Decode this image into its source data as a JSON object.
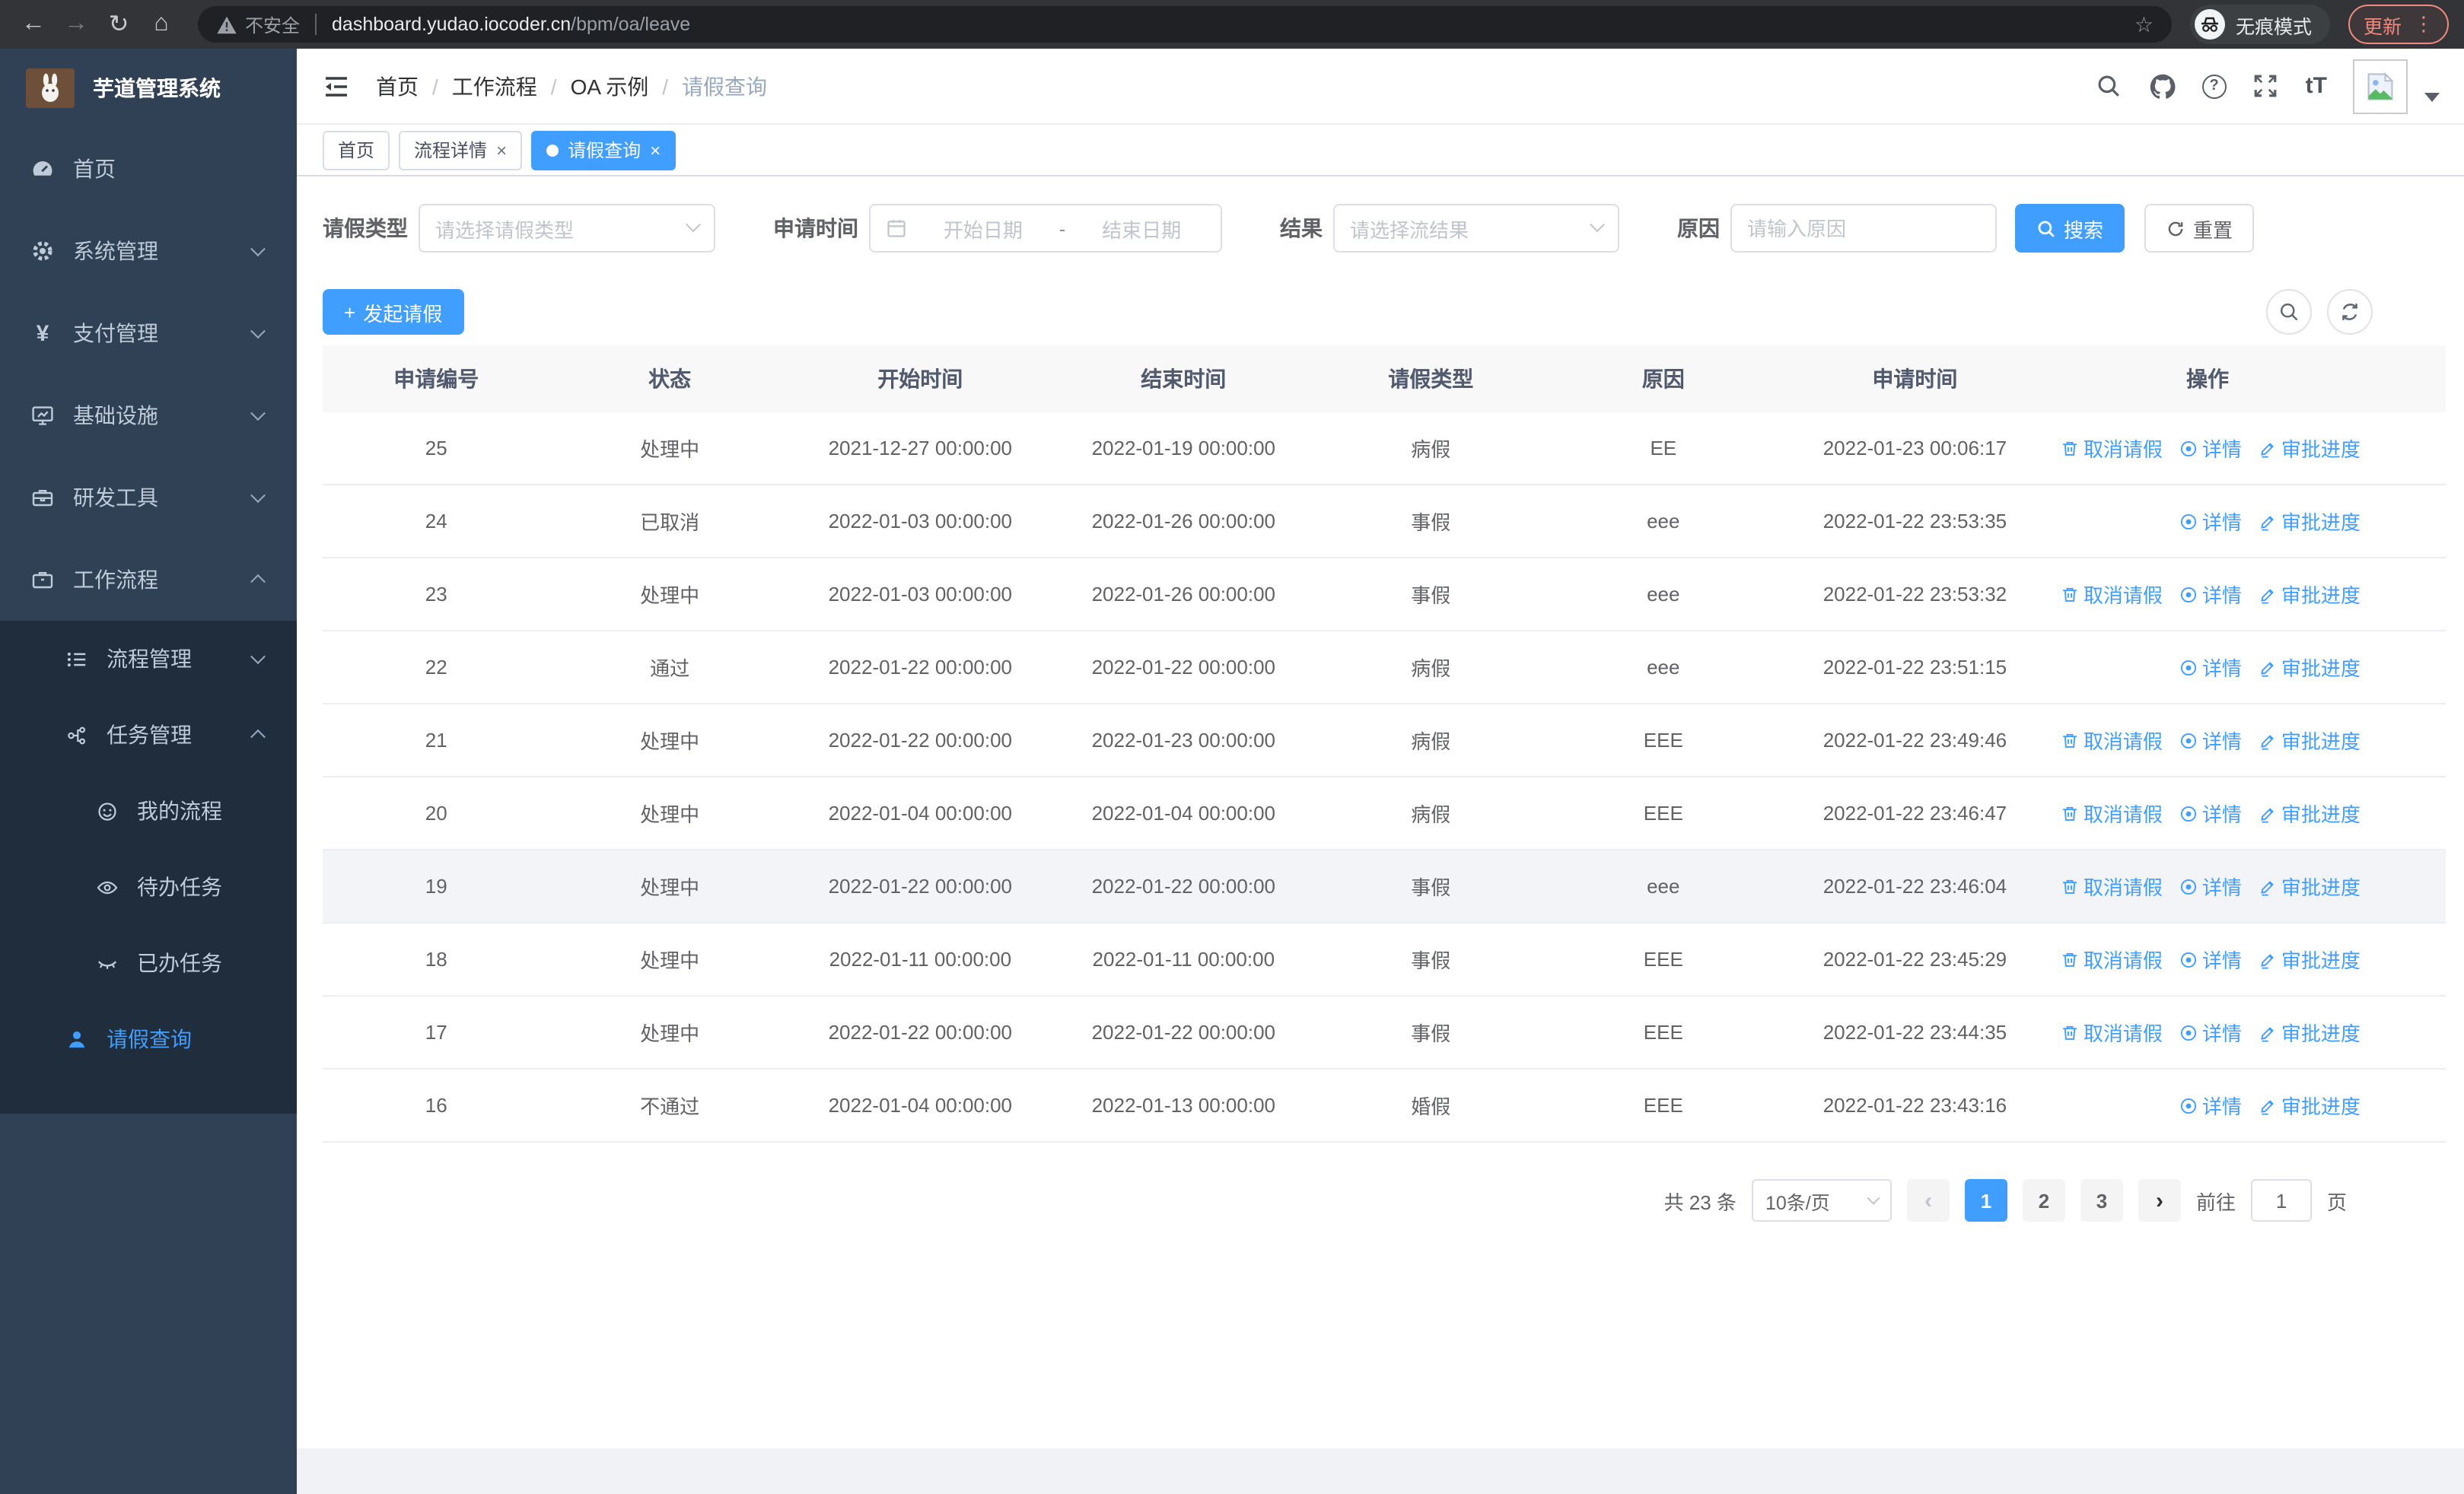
{
  "browser": {
    "security_label": "不安全",
    "url_host": "dashboard.yudao.iocoder.cn",
    "url_path": "/bpm/oa/leave",
    "incognito_label": "无痕模式",
    "update_label": "更新"
  },
  "glyphs": {
    "back": "←",
    "forward": "→",
    "reload": "↻",
    "home": "⌂",
    "star": "☆",
    "more": "⋮",
    "plus": "+",
    "prev": "‹",
    "next": "›",
    "close": "×",
    "slash": "/",
    "help": "?",
    "fontsize": "tT",
    "yen": "¥"
  },
  "sidebar": {
    "app_title": "芋道管理系统",
    "home": "首页",
    "system": "系统管理",
    "payment": "支付管理",
    "infra": "基础设施",
    "devtools": "研发工具",
    "workflow": "工作流程",
    "process_mgmt": "流程管理",
    "task_mgmt": "任务管理",
    "my_process": "我的流程",
    "todo_tasks": "待办任务",
    "done_tasks": "已办任务",
    "leave_query": "请假查询"
  },
  "breadcrumb": {
    "home": "首页",
    "workflow": "工作流程",
    "oa": "OA 示例",
    "current": "请假查询"
  },
  "tabs": {
    "home": "首页",
    "process_detail": "流程详情",
    "leave_query": "请假查询"
  },
  "filters": {
    "leave_type_label": "请假类型",
    "leave_type_placeholder": "请选择请假类型",
    "apply_time_label": "申请时间",
    "date_start_placeholder": "开始日期",
    "date_separator": "-",
    "date_end_placeholder": "结束日期",
    "result_label": "结果",
    "result_placeholder": "请选择流结果",
    "reason_label": "原因",
    "reason_placeholder": "请输入原因",
    "search_label": "搜索",
    "reset_label": "重置"
  },
  "toolbar": {
    "create_label": "发起请假"
  },
  "table": {
    "columns": [
      "申请编号",
      "状态",
      "开始时间",
      "结束时间",
      "请假类型",
      "原因",
      "申请时间",
      "操作"
    ],
    "action_labels": {
      "cancel": "取消请假",
      "detail": "详情",
      "progress": "审批进度"
    },
    "rows": [
      {
        "id": "25",
        "status": "处理中",
        "start": "2021-12-27 00:00:00",
        "end": "2022-01-19 00:00:00",
        "type": "病假",
        "reason": "EE",
        "applied": "2022-01-23 00:06:17",
        "has_cancel": true
      },
      {
        "id": "24",
        "status": "已取消",
        "start": "2022-01-03 00:00:00",
        "end": "2022-01-26 00:00:00",
        "type": "事假",
        "reason": "eee",
        "applied": "2022-01-22 23:53:35",
        "has_cancel": false
      },
      {
        "id": "23",
        "status": "处理中",
        "start": "2022-01-03 00:00:00",
        "end": "2022-01-26 00:00:00",
        "type": "事假",
        "reason": "eee",
        "applied": "2022-01-22 23:53:32",
        "has_cancel": true
      },
      {
        "id": "22",
        "status": "通过",
        "start": "2022-01-22 00:00:00",
        "end": "2022-01-22 00:00:00",
        "type": "病假",
        "reason": "eee",
        "applied": "2022-01-22 23:51:15",
        "has_cancel": false
      },
      {
        "id": "21",
        "status": "处理中",
        "start": "2022-01-22 00:00:00",
        "end": "2022-01-23 00:00:00",
        "type": "病假",
        "reason": "EEE",
        "applied": "2022-01-22 23:49:46",
        "has_cancel": true
      },
      {
        "id": "20",
        "status": "处理中",
        "start": "2022-01-04 00:00:00",
        "end": "2022-01-04 00:00:00",
        "type": "病假",
        "reason": "EEE",
        "applied": "2022-01-22 23:46:47",
        "has_cancel": true
      },
      {
        "id": "19",
        "status": "处理中",
        "start": "2022-01-22 00:00:00",
        "end": "2022-01-22 00:00:00",
        "type": "事假",
        "reason": "eee",
        "applied": "2022-01-22 23:46:04",
        "has_cancel": true,
        "highlighted": true
      },
      {
        "id": "18",
        "status": "处理中",
        "start": "2022-01-11 00:00:00",
        "end": "2022-01-11 00:00:00",
        "type": "事假",
        "reason": "EEE",
        "applied": "2022-01-22 23:45:29",
        "has_cancel": true
      },
      {
        "id": "17",
        "status": "处理中",
        "start": "2022-01-22 00:00:00",
        "end": "2022-01-22 00:00:00",
        "type": "事假",
        "reason": "EEE",
        "applied": "2022-01-22 23:44:35",
        "has_cancel": true
      },
      {
        "id": "16",
        "status": "不通过",
        "start": "2022-01-04 00:00:00",
        "end": "2022-01-13 00:00:00",
        "type": "婚假",
        "reason": "EEE",
        "applied": "2022-01-22 23:43:16",
        "has_cancel": false
      }
    ]
  },
  "pagination": {
    "total_label": "共 23 条",
    "page_size_label": "10条/页",
    "pages": [
      "1",
      "2",
      "3"
    ],
    "goto_label": "前往",
    "goto_value": "1",
    "page_unit": "页"
  },
  "colors": {
    "accent": "#409eff",
    "sidebar_bg": "#304156",
    "submenu_bg": "#1f2d3d",
    "table_header_bg": "#f8f8f9",
    "chrome_bg": "#333437",
    "update_accent": "#ef8a80"
  }
}
